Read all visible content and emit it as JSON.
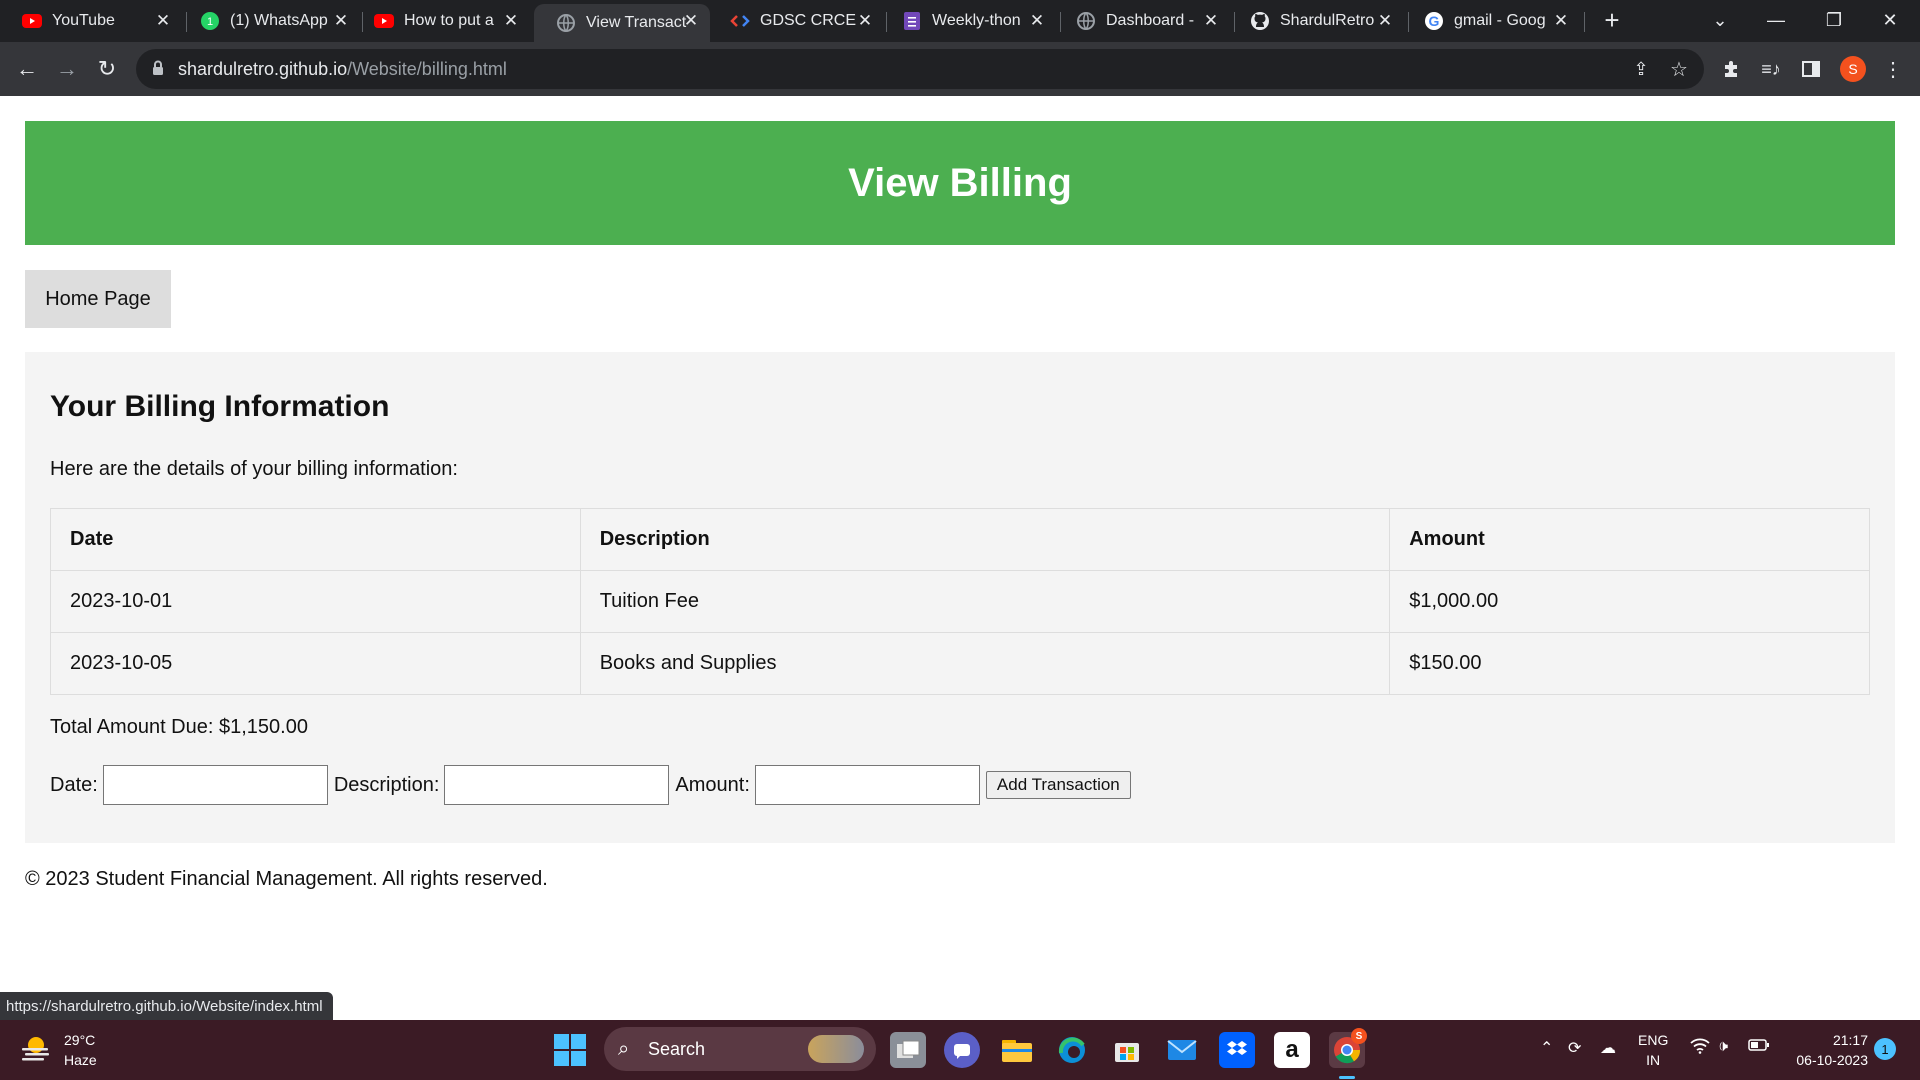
{
  "browser": {
    "tabs": [
      {
        "title": "YouTube",
        "icon": "youtube-icon"
      },
      {
        "title": "(1) WhatsApp",
        "icon": "whatsapp-icon"
      },
      {
        "title": "How to put a",
        "icon": "youtube-icon"
      },
      {
        "title": "View Transact",
        "icon": "globe-icon",
        "active": true
      },
      {
        "title": "GDSC CRCE",
        "icon": "gdsc-icon"
      },
      {
        "title": "Weekly-thon",
        "icon": "forms-icon"
      },
      {
        "title": "Dashboard - ",
        "icon": "globe-icon"
      },
      {
        "title": "ShardulRetro",
        "icon": "github-icon"
      },
      {
        "title": "gmail - Goog",
        "icon": "google-icon"
      }
    ],
    "new_tab": "+",
    "address": {
      "host": "shardulretro.github.io",
      "path": "/Website/billing.html"
    },
    "profile_initial": "S",
    "status_url": "https://shardulretro.github.io/Website/index.html"
  },
  "page": {
    "header_title": "View Billing",
    "home_button": "Home Page",
    "section_title": "Your Billing Information",
    "intro": "Here are the details of your billing information:",
    "table": {
      "headers": [
        "Date",
        "Description",
        "Amount"
      ],
      "rows": [
        [
          "2023-10-01",
          "Tuition Fee",
          "$1,000.00"
        ],
        [
          "2023-10-05",
          "Books and Supplies",
          "$150.00"
        ]
      ]
    },
    "total": "Total Amount Due: $1,150.00",
    "form": {
      "date_label": "Date:",
      "description_label": "Description:",
      "amount_label": "Amount:",
      "date_value": "",
      "description_value": "",
      "amount_value": "",
      "submit_label": "Add Transaction"
    },
    "footer": "© 2023 Student Financial Management. All rights reserved.",
    "colors": {
      "header_bg": "#4caf50",
      "panel_bg": "#f4f4f4",
      "button_bg": "#dddddd"
    }
  },
  "taskbar": {
    "weather_temp": "29°C",
    "weather_desc": "Haze",
    "search_label": "Search",
    "lang_top": "ENG",
    "lang_bottom": "IN",
    "time": "21:17",
    "date": "06-10-2023",
    "notification_count": "1",
    "chrome_badge": "S"
  }
}
